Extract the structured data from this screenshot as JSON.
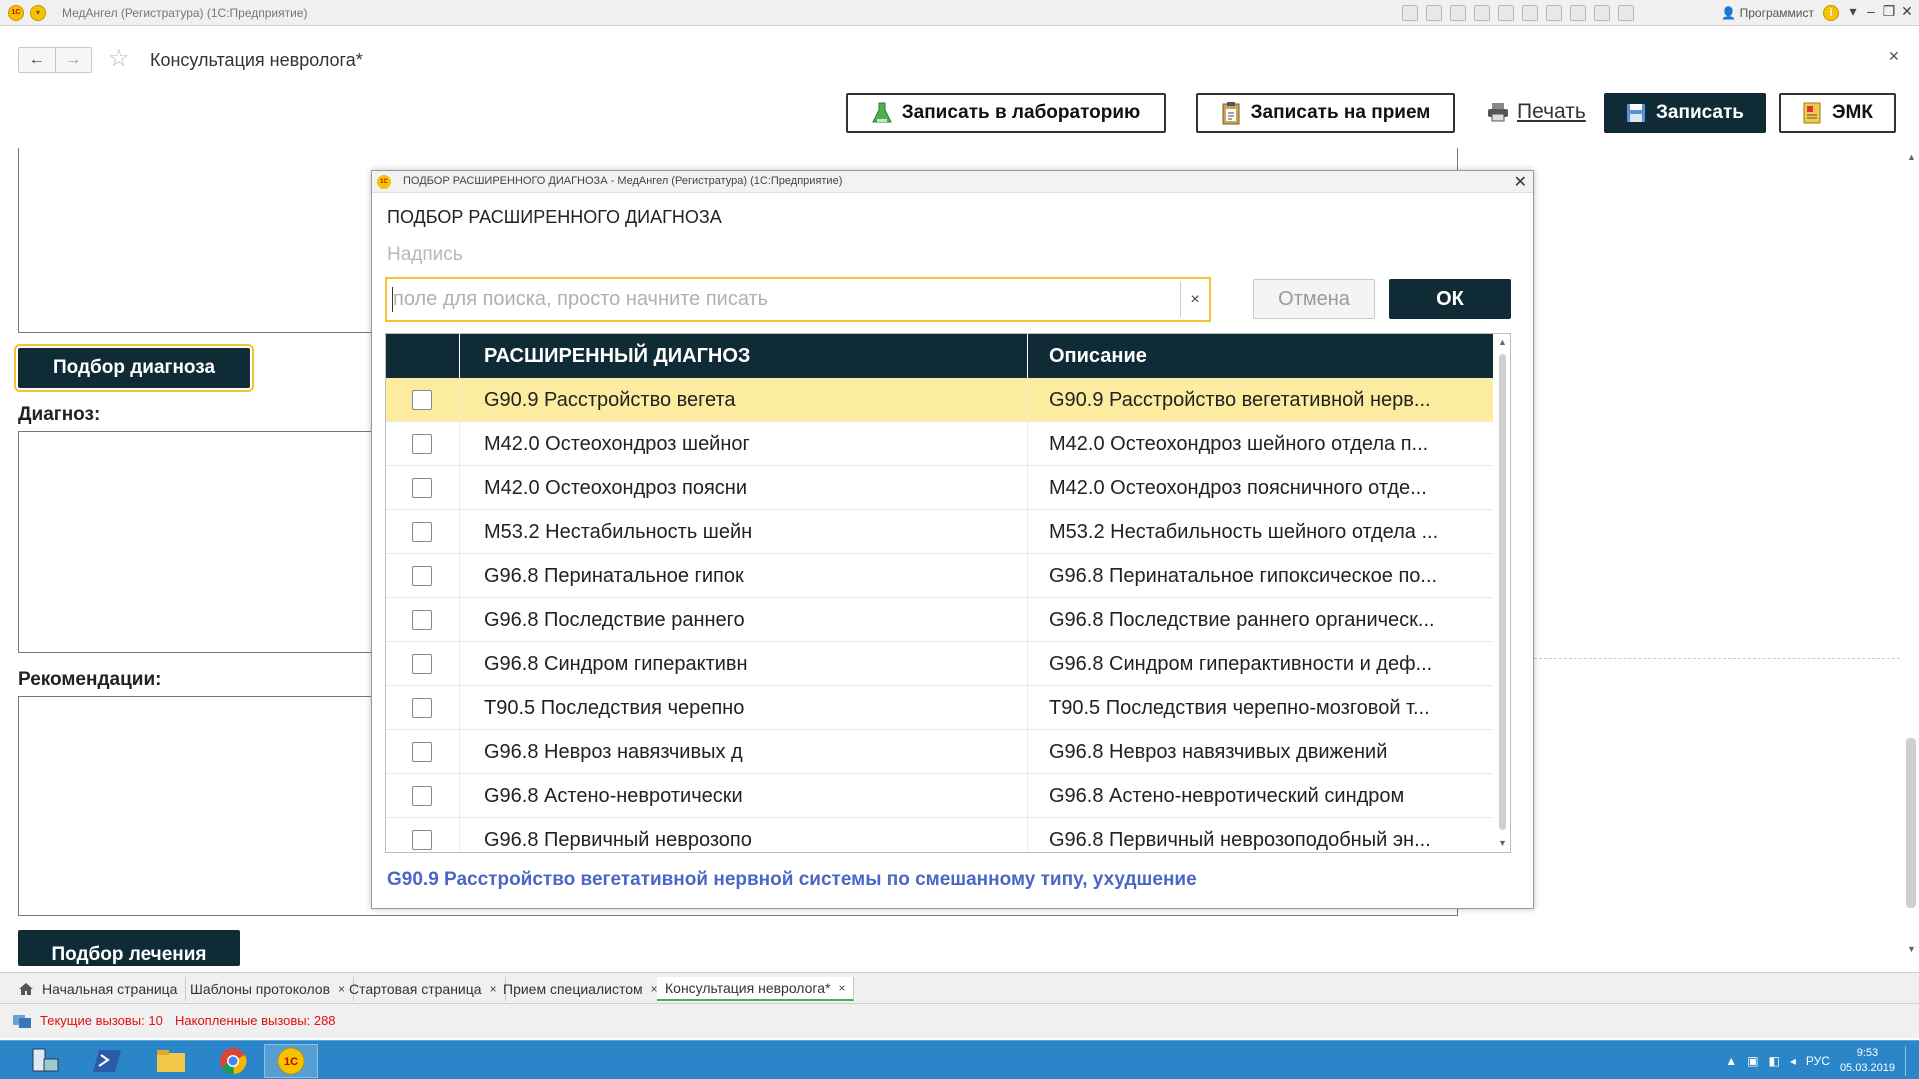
{
  "window": {
    "title": "МедАнгел (Регистратура)  (1С:Предприятие)",
    "user": "Программист",
    "app_icon": "1С"
  },
  "header": {
    "page_title": "Консультация невролога*",
    "buttons": {
      "lab": "Записать в лабораторию",
      "appointment": "Записать на прием",
      "print": "Печать",
      "save": "Записать",
      "emk": "ЭМК"
    }
  },
  "form": {
    "diagnosis_select_button": "Подбор диагноза",
    "diagnosis_label": "Диагноз:",
    "recommendations_label": "Рекомендации:",
    "treatment_select_button": "Подбор лечения"
  },
  "dialog": {
    "window_title": "ПОДБОР РАСШИРЕННОГО ДИАГНОЗА - МедАнгел (Регистратура)  (1С:Предприятие)",
    "icon_text": "1С",
    "heading": "ПОДБОР РАСШИРЕННОГО ДИАГНОЗА",
    "caption": "Надпись",
    "search": {
      "placeholder": "поле для поиска, просто начните писать",
      "value": "",
      "clear_glyph": "×"
    },
    "cancel_button": "Отмена",
    "ok_button": "ОК",
    "columns": {
      "name": "РАСШИРЕННЫЙ ДИАГНОЗ",
      "description": "Описание"
    },
    "rows": [
      {
        "name": "G90.9 Расстройство вегета",
        "description": "G90.9 Расстройство вегетативной нерв...",
        "checked": false,
        "selected": true
      },
      {
        "name": "M42.0 Остеохондроз шейног",
        "description": "M42.0 Остеохондроз шейного отдела п...",
        "checked": false,
        "selected": false
      },
      {
        "name": "M42.0 Остеохондроз поясни",
        "description": "M42.0 Остеохондроз поясничного отде...",
        "checked": false,
        "selected": false
      },
      {
        "name": "M53.2 Нестабильность шейн",
        "description": "M53.2 Нестабильность шейного отдела ...",
        "checked": false,
        "selected": false
      },
      {
        "name": "G96.8 Перинатальное гипок",
        "description": "G96.8 Перинатальное гипоксическое по...",
        "checked": false,
        "selected": false
      },
      {
        "name": "G96.8 Последствие раннего",
        "description": "G96.8 Последствие раннего органическ...",
        "checked": false,
        "selected": false
      },
      {
        "name": "G96.8 Синдром гиперактивн",
        "description": "G96.8 Синдром гиперактивности и деф...",
        "checked": false,
        "selected": false
      },
      {
        "name": "T90.5 Последствия черепно",
        "description": "T90.5 Последствия черепно-мозговой т...",
        "checked": false,
        "selected": false
      },
      {
        "name": "G96.8 Невроз навязчивых д",
        "description": "G96.8 Невроз навязчивых движений",
        "checked": false,
        "selected": false
      },
      {
        "name": "G96.8 Астено-невротически",
        "description": "G96.8 Астено-невротический синдром",
        "checked": false,
        "selected": false
      },
      {
        "name": "G96.8 Первичный неврозопо",
        "description": "G96.8 Первичный неврозоподобный эн...",
        "checked": false,
        "selected": false
      }
    ],
    "footer_text": "G90.9 Расстройство вегетативной нервной системы по смешанному типу, ухудшение"
  },
  "tabs": [
    {
      "label": "Начальная страница",
      "close": "×",
      "active": false
    },
    {
      "label": "Шаблоны протоколов",
      "close": "×",
      "active": false
    },
    {
      "label": "Стартовая страница",
      "close": "×",
      "active": false
    },
    {
      "label": "Прием специалистом",
      "close": "×",
      "active": false
    },
    {
      "label": "Консультация невролога*",
      "close": "×",
      "active": true
    }
  ],
  "status": {
    "current_calls": "Текущие вызовы: 10",
    "accumulated_calls": "Накопленные вызовы: 288"
  },
  "taskbar": {
    "language": "РУС",
    "time": "9:53",
    "date": "05.03.2019",
    "apps": [
      "server-manager-icon",
      "powershell-icon",
      "file-explorer-icon",
      "chrome-icon",
      "1c-icon"
    ]
  },
  "colors": {
    "accent_dark": "#0f2b36",
    "selected_row": "#fbec9f",
    "focus_border": "#f1c232",
    "footer_link": "#4a67c8",
    "status_red": "#e01010",
    "taskbar": "#2a86c8"
  }
}
